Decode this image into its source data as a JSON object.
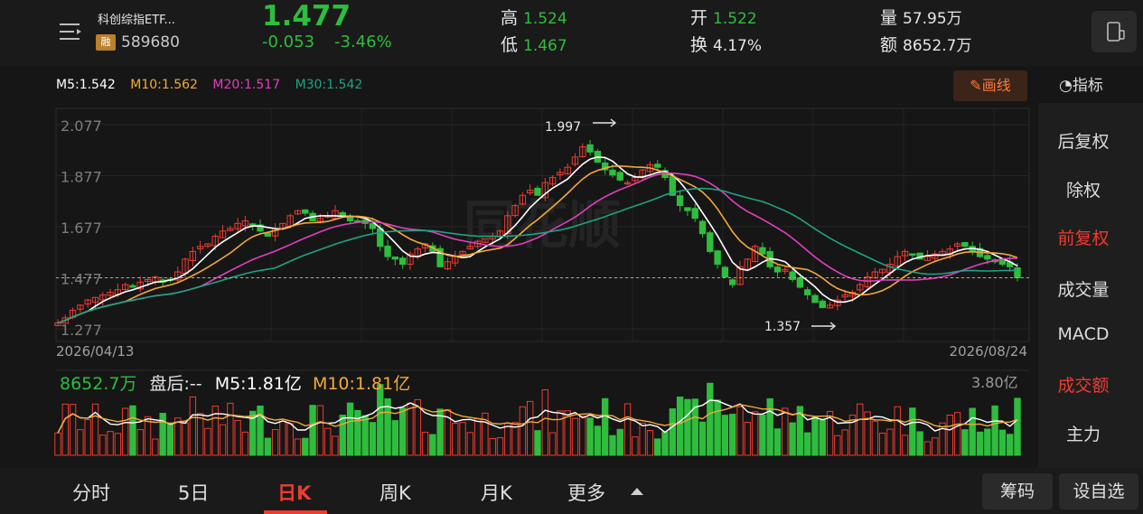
{
  "security": {
    "name": "科创综指ETF...",
    "margin_badge": "融",
    "code": "589680",
    "price": "1.477",
    "change": "-0.053",
    "change_pct": "-3.46%"
  },
  "stats": {
    "high_label": "高",
    "high": "1.524",
    "low_label": "低",
    "low": "1.467",
    "open_label": "开",
    "open": "1.522",
    "turnover_label": "换",
    "turnover": "4.17%",
    "volume_label": "量",
    "volume": "57.95万",
    "amount_label": "额",
    "amount": "8652.7万"
  },
  "ma": {
    "m5": "M5:1.542",
    "m10": "M10:1.562",
    "m20": "M20:1.517",
    "m30": "M30:1.542"
  },
  "toolbar": {
    "draw_label": "画线",
    "indicator_label": "指标"
  },
  "side_menu": [
    "后复权",
    "除权",
    "前复权",
    "成交量",
    "MACD",
    "成交额",
    "主力"
  ],
  "chart_labels": {
    "y_ticks": [
      "2.077",
      "1.877",
      "1.677",
      "1.477",
      "1.277"
    ],
    "start_date": "2026/04/13",
    "end_date": "2026/08/24",
    "max_annotation": "1.997",
    "min_annotation": "1.357",
    "watermark": "同花顺"
  },
  "volume": {
    "current": "8652.7万",
    "after_hours": "盘后:--",
    "m5": "M5:1.81亿",
    "m10": "M10:1.81亿",
    "max_label": "3.80亿"
  },
  "tabs": [
    "分时",
    "5日",
    "日K",
    "周K",
    "月K",
    "更多"
  ],
  "active_tab": "日K",
  "bottom_buttons": {
    "chips": "筹码",
    "add_watch": "设自选"
  },
  "colors": {
    "up": "#ef3b30",
    "down": "#2fbd3e",
    "ma5": "#ffffff",
    "ma10": "#f3a93b",
    "ma20": "#e23fbf",
    "ma30": "#1ea381",
    "accent": "#ff7a3d"
  },
  "chart_data": {
    "type": "candlestick",
    "x_range": [
      "2026/04/13",
      "2026/08/24"
    ],
    "ylim": [
      1.277,
      2.077
    ],
    "y_ticks": [
      2.077,
      1.877,
      1.677,
      1.477,
      1.277
    ],
    "current_price": 1.477,
    "max": 1.997,
    "min": 1.357,
    "closes": [
      1.3,
      1.32,
      1.35,
      1.37,
      1.39,
      1.4,
      1.41,
      1.42,
      1.43,
      1.45,
      1.44,
      1.46,
      1.47,
      1.48,
      1.46,
      1.47,
      1.5,
      1.55,
      1.58,
      1.6,
      1.61,
      1.64,
      1.66,
      1.67,
      1.69,
      1.7,
      1.68,
      1.66,
      1.64,
      1.67,
      1.69,
      1.72,
      1.74,
      1.73,
      1.7,
      1.71,
      1.72,
      1.74,
      1.72,
      1.7,
      1.7,
      1.69,
      1.67,
      1.6,
      1.56,
      1.55,
      1.53,
      1.57,
      1.59,
      1.61,
      1.58,
      1.52,
      1.54,
      1.56,
      1.58,
      1.6,
      1.62,
      1.63,
      1.64,
      1.66,
      1.72,
      1.76,
      1.8,
      1.82,
      1.8,
      1.85,
      1.87,
      1.89,
      1.91,
      1.95,
      1.99,
      1.97,
      1.93,
      1.9,
      1.88,
      1.86,
      1.85,
      1.87,
      1.9,
      1.92,
      1.91,
      1.87,
      1.8,
      1.76,
      1.74,
      1.71,
      1.65,
      1.58,
      1.53,
      1.48,
      1.45,
      1.52,
      1.55,
      1.6,
      1.57,
      1.52,
      1.5,
      1.51,
      1.47,
      1.44,
      1.41,
      1.38,
      1.36,
      1.37,
      1.39,
      1.41,
      1.42,
      1.45,
      1.48,
      1.5,
      1.51,
      1.53,
      1.56,
      1.58,
      1.57,
      1.55,
      1.56,
      1.57,
      1.58,
      1.59,
      1.61,
      1.6,
      1.58,
      1.56,
      1.55,
      1.54,
      1.53,
      1.52,
      1.477
    ],
    "volume_max": "3.80亿"
  }
}
